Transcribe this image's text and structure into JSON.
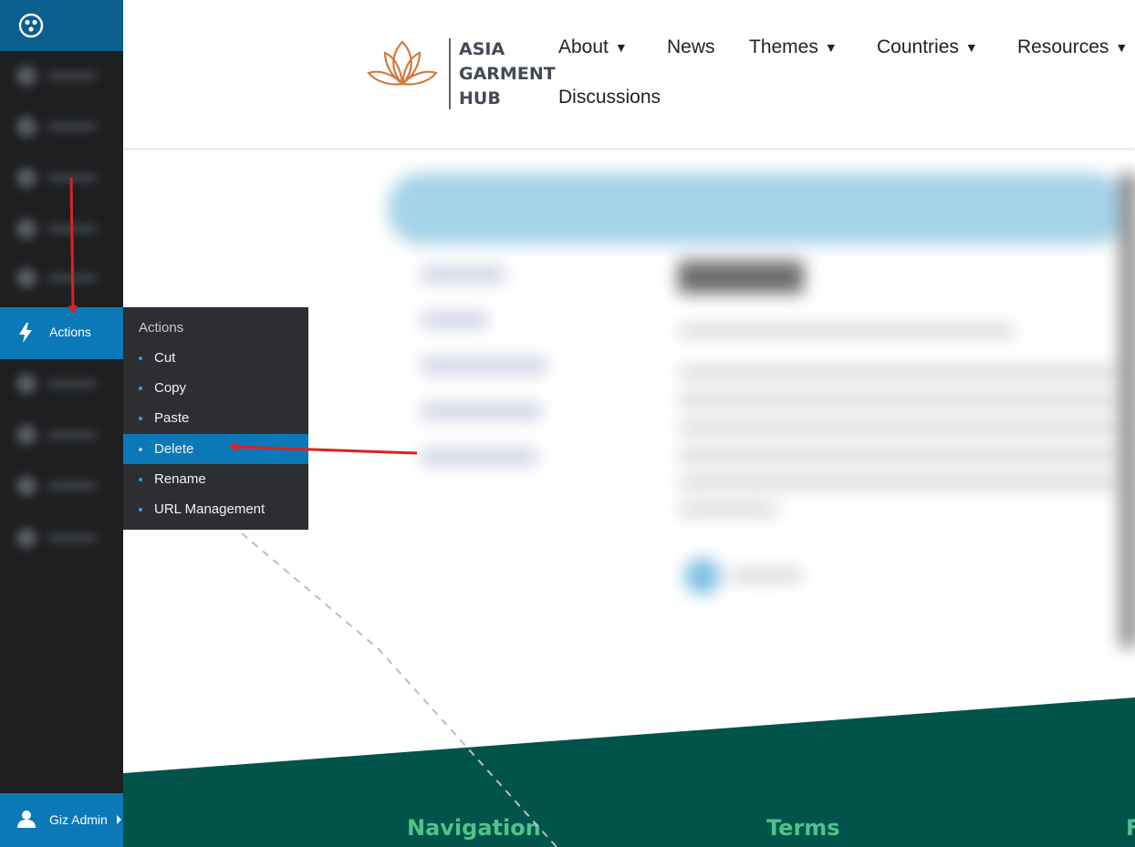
{
  "sidebar": {
    "logo_icon": "community-icon",
    "actions_label": "Actions",
    "actions_icon": "lightning-icon",
    "user_label": "Giz Admin",
    "user_icon": "user-icon"
  },
  "flyout": {
    "title": "Actions",
    "items": [
      {
        "label": "Cut"
      },
      {
        "label": "Copy"
      },
      {
        "label": "Paste"
      },
      {
        "label": "Delete",
        "active": true
      },
      {
        "label": "Rename"
      },
      {
        "label": "URL Management"
      }
    ]
  },
  "site": {
    "logo_lines": [
      "ASIA",
      "GARMENT",
      "HUB"
    ],
    "nav": [
      {
        "label": "About",
        "dropdown": true
      },
      {
        "label": "News",
        "dropdown": false
      },
      {
        "label": "Themes",
        "dropdown": true
      },
      {
        "label": "Countries",
        "dropdown": true
      },
      {
        "label": "Resources",
        "dropdown": true
      },
      {
        "label": "Discussions",
        "dropdown": false
      }
    ],
    "dropdown_arrow": "▼"
  },
  "footer": {
    "headings": [
      "Navigation",
      "Terms",
      "F"
    ]
  },
  "colors": {
    "admin_blue": "#0b78b8",
    "sidebar_dark": "#1d1f21",
    "flyout_dark": "#2c2e31",
    "footer_green": "#01544a",
    "footer_heading": "#4fc38b",
    "annotation_red": "#e02020"
  }
}
